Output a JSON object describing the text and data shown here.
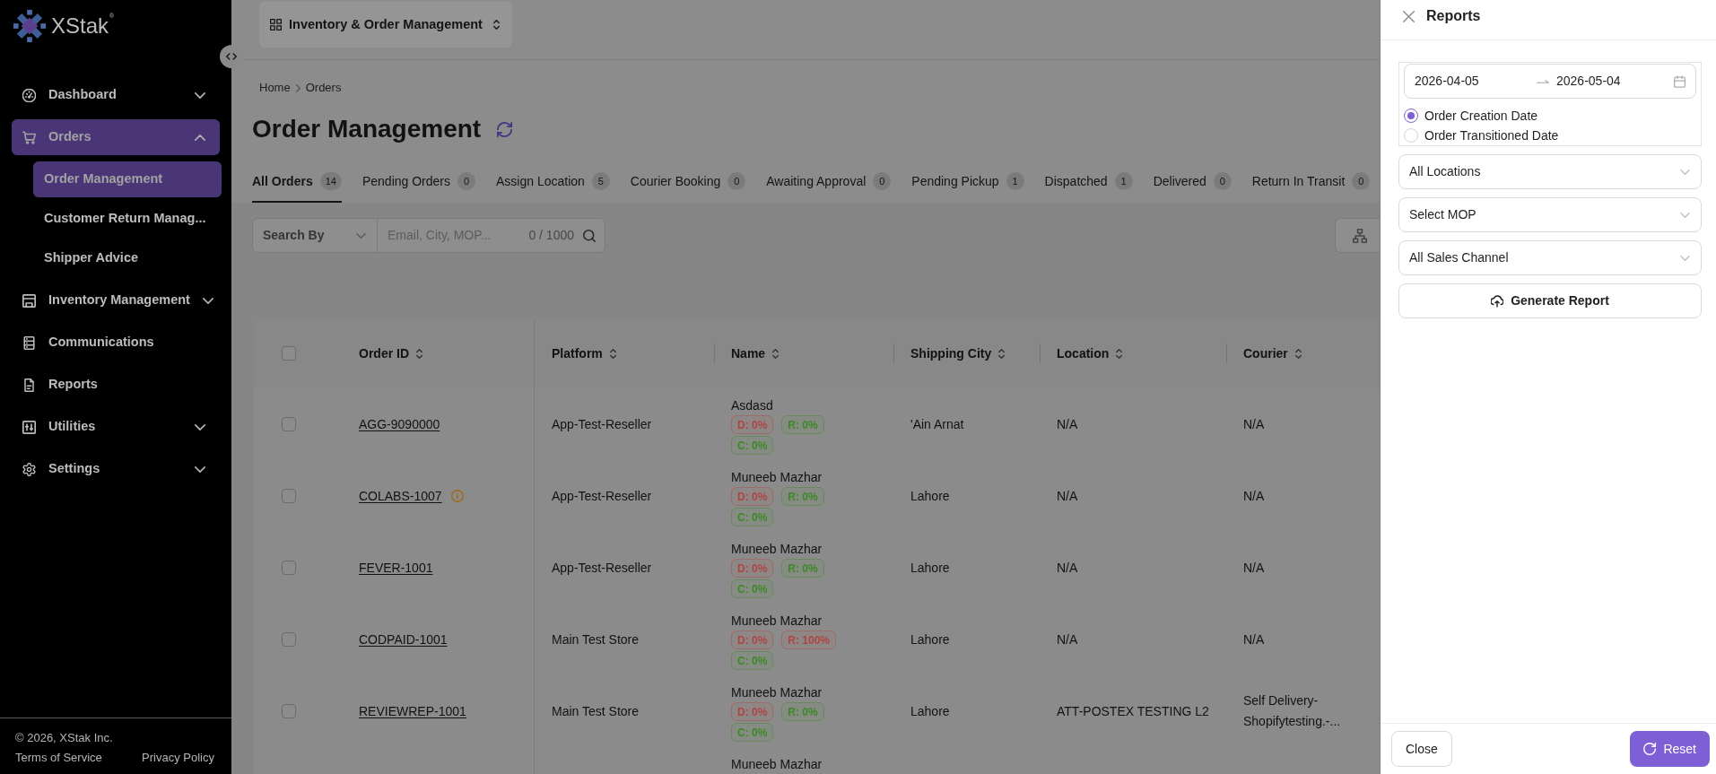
{
  "sidebar": {
    "logo": "XStak$^{®}$",
    "items": [
      {
        "label": "Dashboard",
        "selected": false,
        "expanded": false
      },
      {
        "label": "Orders",
        "selected": true,
        "expanded": true,
        "children": [
          {
            "label": "Order Management",
            "selected": true
          },
          {
            "label": "Customer Return Manag...",
            "selected": false
          },
          {
            "label": "Shipper Advice",
            "selected": false
          }
        ]
      },
      {
        "label": "Inventory Management",
        "selected": false,
        "expanded": false
      },
      {
        "label": "Communications",
        "selected": false
      },
      {
        "label": "Reports",
        "selected": false
      },
      {
        "label": "Utilities",
        "selected": false,
        "expanded": false
      },
      {
        "label": "Settings",
        "selected": false,
        "expanded": false
      }
    ],
    "footer": {
      "copyright": "© 2026, XStak Inc.",
      "links": [
        "Terms of Service",
        "Privacy Policy"
      ]
    }
  },
  "top_bar": {
    "app_switcher": "Inventory & Order Management"
  },
  "breadcrumb": [
    "Home",
    "Orders"
  ],
  "title": "Order Management",
  "tabs": [
    {
      "label": "All Orders",
      "count": "14",
      "selected": true
    },
    {
      "label": "Pending Orders",
      "count": "0",
      "selected": false
    },
    {
      "label": "Assign Location",
      "count": "5",
      "selected": false
    },
    {
      "label": "Courier Booking",
      "count": "0",
      "selected": false
    },
    {
      "label": "Awaiting Approval",
      "count": "0",
      "selected": false
    },
    {
      "label": "Pending Pickup",
      "count": "1",
      "selected": false
    },
    {
      "label": "Dispatched",
      "count": "1",
      "selected": false
    },
    {
      "label": "Delivered",
      "count": "0",
      "selected": false
    },
    {
      "label": "Return In Transit",
      "count": "0",
      "selected": false
    }
  ],
  "search": {
    "search_by": "Search By",
    "placeholder": "Email, City, MOP...",
    "counter": "0 / 1000"
  },
  "table": {
    "all_checked": false,
    "columns": [
      "Order ID",
      "Platform",
      "Name",
      "Shipping City",
      "Location",
      "Courier"
    ],
    "rows": [
      {
        "checked": false,
        "order_id": "AGG-9090000",
        "info": false,
        "platform": "App-Test-Reseller",
        "name": "Asdasd",
        "badges": [
          {
            "text": "D: 0%",
            "color": "#b04444"
          },
          {
            "text": "R: 0%",
            "color": "#3c8a24"
          },
          {
            "text": "C: 0%",
            "color": "#3c8a24"
          }
        ],
        "shipping_city": "'Ain Arnat",
        "location": "N/A",
        "courier": "N/A"
      },
      {
        "checked": false,
        "order_id": "COLABS-1007",
        "info": true,
        "platform": "App-Test-Reseller",
        "name": "Muneeb Mazhar",
        "badges": [
          {
            "text": "D: 0%",
            "color": "#b04444"
          },
          {
            "text": "R: 0%",
            "color": "#3c8a24"
          },
          {
            "text": "C: 0%",
            "color": "#3c8a24"
          }
        ],
        "shipping_city": "Lahore",
        "location": "N/A",
        "courier": "N/A"
      },
      {
        "checked": false,
        "order_id": "FEVER-1001",
        "info": false,
        "platform": "App-Test-Reseller",
        "name": "Muneeb Mazhar",
        "badges": [
          {
            "text": "D: 0%",
            "color": "#b04444"
          },
          {
            "text": "R: 0%",
            "color": "#3c8a24"
          },
          {
            "text": "C: 0%",
            "color": "#3c8a24"
          }
        ],
        "shipping_city": "Lahore",
        "location": "N/A",
        "courier": "N/A"
      },
      {
        "checked": false,
        "order_id": "CODPAID-1001",
        "info": false,
        "platform": "Main Test Store",
        "name": "Muneeb Mazhar",
        "badges": [
          {
            "text": "D: 0%",
            "color": "#b04444"
          },
          {
            "text": "R: 100%",
            "color": "#b04444"
          },
          {
            "text": "C: 0%",
            "color": "#3c8a24"
          }
        ],
        "shipping_city": "Lahore",
        "location": "N/A",
        "courier": "N/A"
      },
      {
        "checked": false,
        "order_id": "REVIEWREP-1001",
        "info": false,
        "platform": "Main Test Store",
        "name": "Muneeb Mazhar",
        "badges": [
          {
            "text": "D: 0%",
            "color": "#b04444"
          },
          {
            "text": "R: 0%",
            "color": "#3c8a24"
          },
          {
            "text": "C: 0%",
            "color": "#3c8a24"
          }
        ],
        "shipping_city": "Lahore",
        "location": "ATT-POSTEX TESTING L2",
        "courier": "Self Delivery-Shopifytesting.-..."
      },
      {
        "name": "Muneeb Mazhar"
      }
    ]
  },
  "drawer": {
    "title": "Reports",
    "date_range": {
      "start": "2026-04-05",
      "end": "2026-05-04"
    },
    "date_basis": [
      {
        "label": "Order Creation Date",
        "selected": true
      },
      {
        "label": "Order Transitioned Date",
        "selected": false
      }
    ],
    "selects": [
      "All Locations",
      "Select MOP",
      "All Sales Channel"
    ],
    "generate_button": "Generate Report",
    "buttons": [
      {
        "label": "Close",
        "kind": "secondary"
      },
      {
        "label": "Reset",
        "kind": "primary"
      }
    ]
  }
}
